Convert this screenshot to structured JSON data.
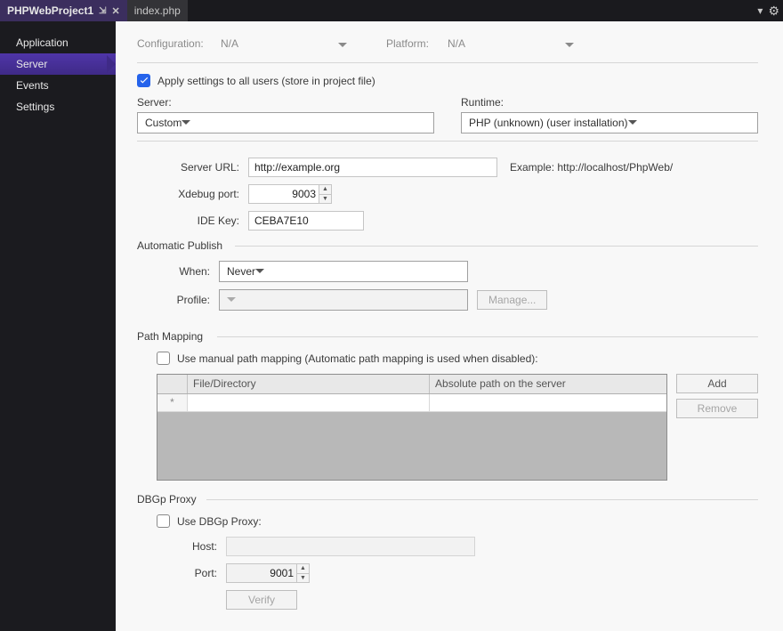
{
  "tabs": {
    "active": "PHPWebProject1",
    "inactive": "index.php"
  },
  "sidebar": {
    "items": [
      "Application",
      "Server",
      "Events",
      "Settings"
    ],
    "selected": "Server"
  },
  "cfg": {
    "configuration_label": "Configuration:",
    "configuration_value": "N/A",
    "platform_label": "Platform:",
    "platform_value": "N/A"
  },
  "apply_all_label": "Apply settings to all users (store in project file)",
  "server": {
    "label": "Server:",
    "value": "Custom"
  },
  "runtime": {
    "label": "Runtime:",
    "value": "PHP (unknown) (user installation)"
  },
  "fields": {
    "server_url": {
      "label": "Server URL:",
      "value": "http://example.org",
      "example": "Example: http://localhost/PhpWeb/"
    },
    "xdebug_port": {
      "label": "Xdebug port:",
      "value": "9003"
    },
    "ide_key": {
      "label": "IDE Key:",
      "value": "CEBA7E10"
    }
  },
  "auto_publish": {
    "title": "Automatic Publish",
    "when_label": "When:",
    "when_value": "Never",
    "profile_label": "Profile:",
    "profile_value": "",
    "manage_btn": "Manage..."
  },
  "path_mapping": {
    "title": "Path Mapping",
    "chk_label": "Use manual path mapping (Automatic path mapping is used when disabled):",
    "col_file": "File/Directory",
    "col_abs": "Absolute path on the server",
    "new_marker": "*",
    "add_btn": "Add",
    "remove_btn": "Remove"
  },
  "dbgp": {
    "title": "DBGp Proxy",
    "chk_label": "Use DBGp Proxy:",
    "host_label": "Host:",
    "host_value": "",
    "port_label": "Port:",
    "port_value": "9001",
    "verify_btn": "Verify"
  }
}
